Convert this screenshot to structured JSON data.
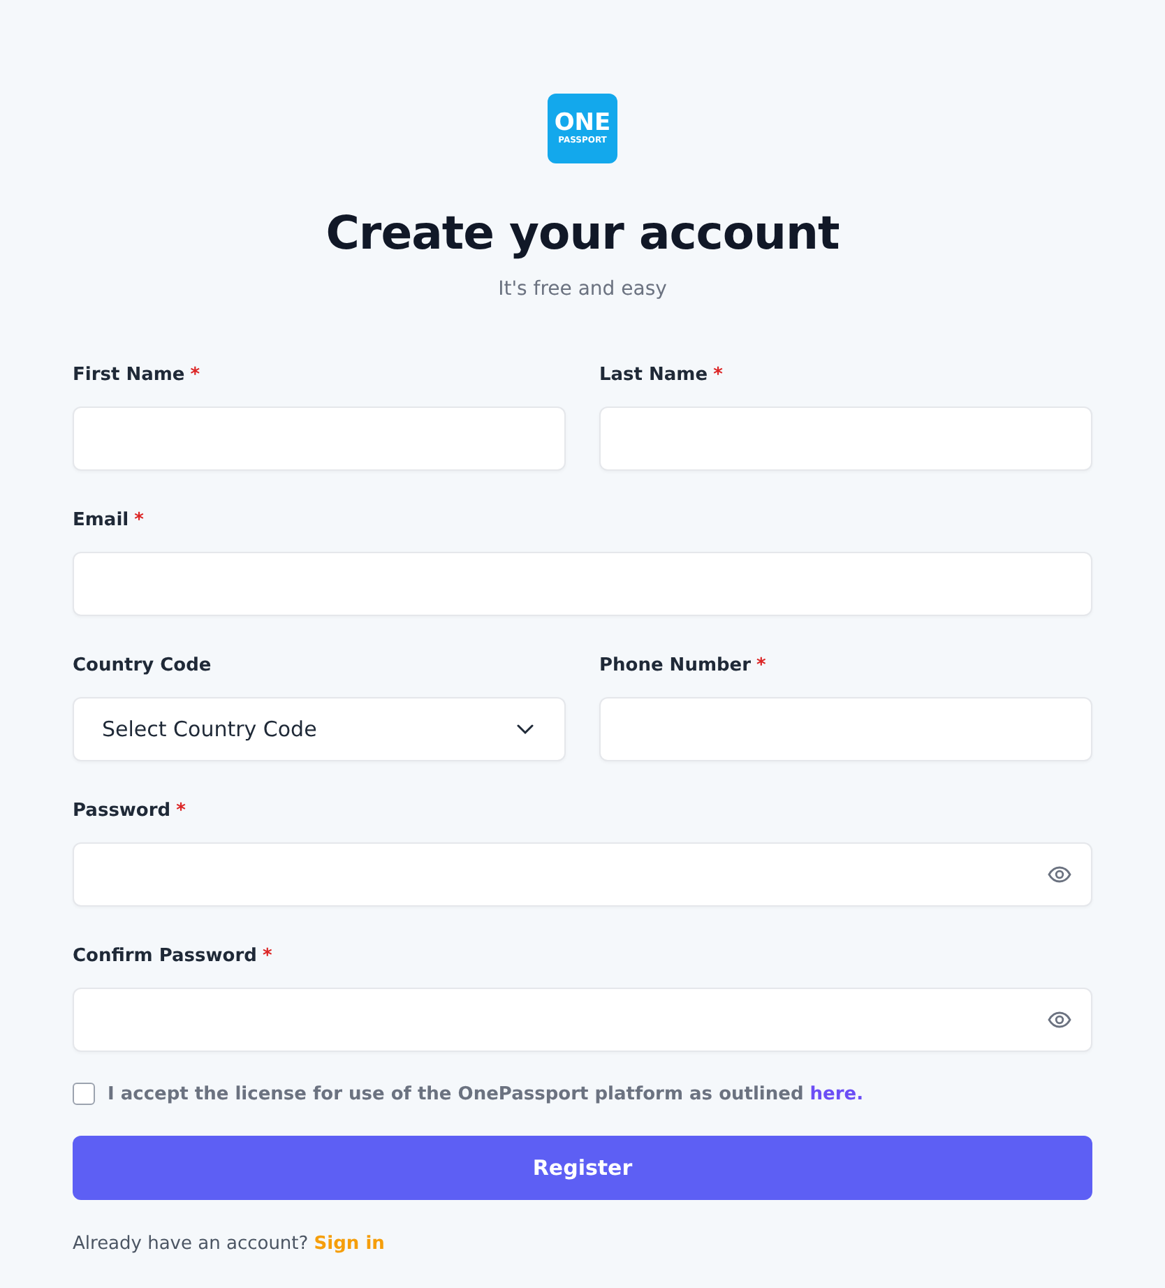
{
  "logo": {
    "line_1": "ONE",
    "line_2": "PASSPORT"
  },
  "title": "Create your account",
  "subtitle": "It's free and easy",
  "rows": [
    [
      {
        "kind": "text",
        "label": "First Name",
        "required_mark": "*"
      },
      {
        "kind": "text",
        "label": "Last Name",
        "required_mark": "*"
      }
    ],
    [
      {
        "kind": "text",
        "label": "Email",
        "required_mark": "*"
      }
    ],
    [
      {
        "kind": "select",
        "label": "Country Code",
        "value": "Select Country Code"
      },
      {
        "kind": "text",
        "label": "Phone Number",
        "required_mark": "*"
      }
    ],
    [
      {
        "kind": "password",
        "label": "Password",
        "required_mark": "*"
      }
    ],
    [
      {
        "kind": "password",
        "label": "Confirm Password",
        "required_mark": "*"
      }
    ]
  ],
  "license": {
    "checked": false,
    "text": "I accept the license for use of the OnePassport platform as outlined",
    "link": "here."
  },
  "register_button": "Register",
  "signin": {
    "text": "Already have an account?",
    "link": "Sign in"
  }
}
